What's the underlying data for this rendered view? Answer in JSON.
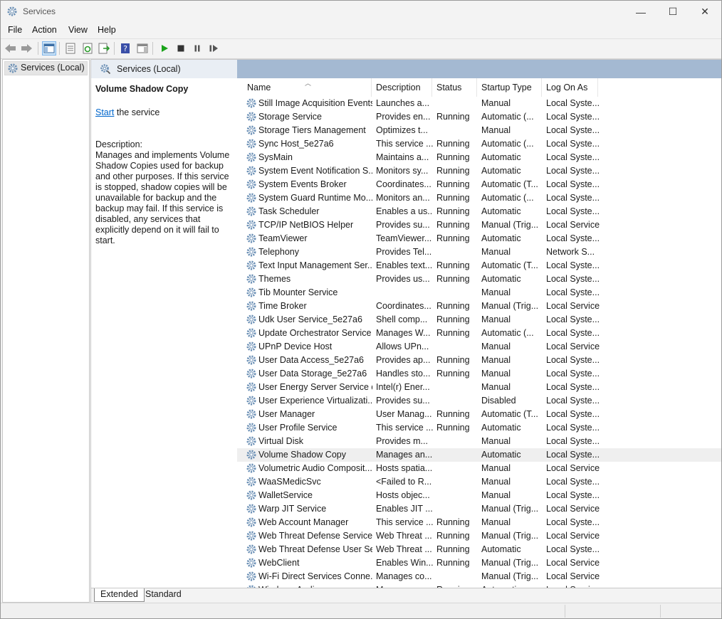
{
  "window": {
    "title": "Services",
    "minimize": "—",
    "maximize": "☐",
    "close": "✕"
  },
  "menu": [
    "File",
    "Action",
    "View",
    "Help"
  ],
  "toolbar": {
    "icons": [
      "back-icon",
      "forward-icon",
      "show-hide-console-tree-icon",
      "properties-icon",
      "refresh-icon",
      "export-list-icon",
      "help-icon",
      "show-hide-action-pane-icon",
      "start-service-icon",
      "stop-service-icon",
      "pause-service-icon",
      "restart-service-icon"
    ]
  },
  "tree": {
    "root": "Services (Local)"
  },
  "pane": {
    "header": "Services (Local)"
  },
  "details": {
    "title": "Volume Shadow Copy",
    "start_link": "Start",
    "start_suffix": " the service",
    "description_label": "Description:",
    "description": "Manages and implements Volume Shadow Copies used for backup and other purposes. If this service is stopped, shadow copies will be unavailable for backup and the backup may fail. If this service is disabled, any services that explicitly depend on it will fail to start."
  },
  "columns": {
    "name": "Name",
    "description": "Description",
    "status": "Status",
    "startup": "Startup Type",
    "logon": "Log On As"
  },
  "services": [
    {
      "name": "Still Image Acquisition Events",
      "desc": "Launches a...",
      "status": "",
      "startup": "Manual",
      "logon": "Local Syste..."
    },
    {
      "name": "Storage Service",
      "desc": "Provides en...",
      "status": "Running",
      "startup": "Automatic (...",
      "logon": "Local Syste..."
    },
    {
      "name": "Storage Tiers Management",
      "desc": "Optimizes t...",
      "status": "",
      "startup": "Manual",
      "logon": "Local Syste..."
    },
    {
      "name": "Sync Host_5e27a6",
      "desc": "This service ...",
      "status": "Running",
      "startup": "Automatic (...",
      "logon": "Local Syste..."
    },
    {
      "name": "SysMain",
      "desc": "Maintains a...",
      "status": "Running",
      "startup": "Automatic",
      "logon": "Local Syste..."
    },
    {
      "name": "System Event Notification S...",
      "desc": "Monitors sy...",
      "status": "Running",
      "startup": "Automatic",
      "logon": "Local Syste..."
    },
    {
      "name": "System Events Broker",
      "desc": "Coordinates...",
      "status": "Running",
      "startup": "Automatic (T...",
      "logon": "Local Syste..."
    },
    {
      "name": "System Guard Runtime Mo...",
      "desc": "Monitors an...",
      "status": "Running",
      "startup": "Automatic (...",
      "logon": "Local Syste..."
    },
    {
      "name": "Task Scheduler",
      "desc": "Enables a us...",
      "status": "Running",
      "startup": "Automatic",
      "logon": "Local Syste..."
    },
    {
      "name": "TCP/IP NetBIOS Helper",
      "desc": "Provides su...",
      "status": "Running",
      "startup": "Manual (Trig...",
      "logon": "Local Service"
    },
    {
      "name": "TeamViewer",
      "desc": "TeamViewer...",
      "status": "Running",
      "startup": "Automatic",
      "logon": "Local Syste..."
    },
    {
      "name": "Telephony",
      "desc": "Provides Tel...",
      "status": "",
      "startup": "Manual",
      "logon": "Network S..."
    },
    {
      "name": "Text Input Management Ser...",
      "desc": "Enables text...",
      "status": "Running",
      "startup": "Automatic (T...",
      "logon": "Local Syste..."
    },
    {
      "name": "Themes",
      "desc": "Provides us...",
      "status": "Running",
      "startup": "Automatic",
      "logon": "Local Syste..."
    },
    {
      "name": "Tib Mounter Service",
      "desc": "",
      "status": "",
      "startup": "Manual",
      "logon": "Local Syste..."
    },
    {
      "name": "Time Broker",
      "desc": "Coordinates...",
      "status": "Running",
      "startup": "Manual (Trig...",
      "logon": "Local Service"
    },
    {
      "name": "Udk User Service_5e27a6",
      "desc": "Shell comp...",
      "status": "Running",
      "startup": "Manual",
      "logon": "Local Syste..."
    },
    {
      "name": "Update Orchestrator Service",
      "desc": "Manages W...",
      "status": "Running",
      "startup": "Automatic (...",
      "logon": "Local Syste..."
    },
    {
      "name": "UPnP Device Host",
      "desc": "Allows UPn...",
      "status": "",
      "startup": "Manual",
      "logon": "Local Service"
    },
    {
      "name": "User Data Access_5e27a6",
      "desc": "Provides ap...",
      "status": "Running",
      "startup": "Manual",
      "logon": "Local Syste..."
    },
    {
      "name": "User Data Storage_5e27a6",
      "desc": "Handles sto...",
      "status": "Running",
      "startup": "Manual",
      "logon": "Local Syste..."
    },
    {
      "name": "User Energy Server Service q...",
      "desc": "Intel(r) Ener...",
      "status": "",
      "startup": "Manual",
      "logon": "Local Syste..."
    },
    {
      "name": "User Experience Virtualizati...",
      "desc": "Provides su...",
      "status": "",
      "startup": "Disabled",
      "logon": "Local Syste..."
    },
    {
      "name": "User Manager",
      "desc": "User Manag...",
      "status": "Running",
      "startup": "Automatic (T...",
      "logon": "Local Syste..."
    },
    {
      "name": "User Profile Service",
      "desc": "This service ...",
      "status": "Running",
      "startup": "Automatic",
      "logon": "Local Syste..."
    },
    {
      "name": "Virtual Disk",
      "desc": "Provides m...",
      "status": "",
      "startup": "Manual",
      "logon": "Local Syste..."
    },
    {
      "name": "Volume Shadow Copy",
      "desc": "Manages an...",
      "status": "",
      "startup": "Automatic",
      "logon": "Local Syste...",
      "selected": true
    },
    {
      "name": "Volumetric Audio Composit...",
      "desc": "Hosts spatia...",
      "status": "",
      "startup": "Manual",
      "logon": "Local Service"
    },
    {
      "name": "WaaSMedicSvc",
      "desc": "<Failed to R...",
      "status": "",
      "startup": "Manual",
      "logon": "Local Syste..."
    },
    {
      "name": "WalletService",
      "desc": "Hosts objec...",
      "status": "",
      "startup": "Manual",
      "logon": "Local Syste..."
    },
    {
      "name": "Warp JIT Service",
      "desc": "Enables JIT ...",
      "status": "",
      "startup": "Manual (Trig...",
      "logon": "Local Service"
    },
    {
      "name": "Web Account Manager",
      "desc": "This service ...",
      "status": "Running",
      "startup": "Manual",
      "logon": "Local Syste..."
    },
    {
      "name": "Web Threat Defense Service",
      "desc": "Web Threat ...",
      "status": "Running",
      "startup": "Manual (Trig...",
      "logon": "Local Service"
    },
    {
      "name": "Web Threat Defense User Se...",
      "desc": "Web Threat ...",
      "status": "Running",
      "startup": "Automatic",
      "logon": "Local Syste..."
    },
    {
      "name": "WebClient",
      "desc": "Enables Win...",
      "status": "Running",
      "startup": "Manual (Trig...",
      "logon": "Local Service"
    },
    {
      "name": "Wi-Fi Direct Services Conne...",
      "desc": "Manages co...",
      "status": "",
      "startup": "Manual (Trig...",
      "logon": "Local Service"
    },
    {
      "name": "Windows Audio",
      "desc": "Manages au...",
      "status": "Running",
      "startup": "Automatic",
      "logon": "Local Service"
    }
  ],
  "tabs": [
    "Extended",
    "Standard"
  ],
  "colors": {
    "pane_header": "#a4b9d2",
    "link": "#0066cc",
    "selected_row": "#efefef",
    "play_green": "#1aa31a"
  }
}
